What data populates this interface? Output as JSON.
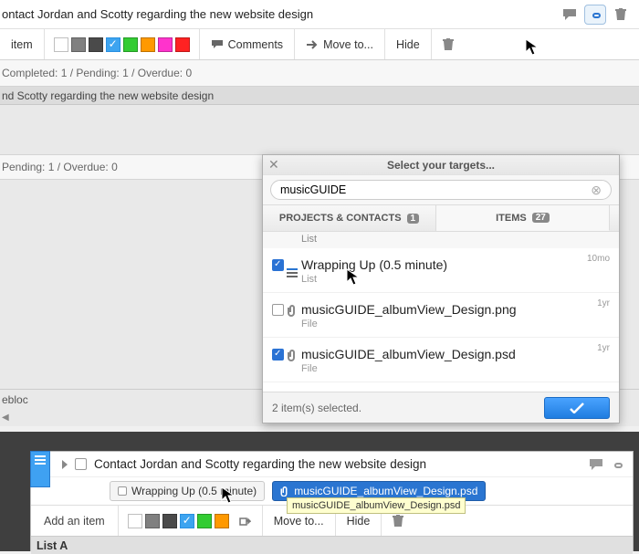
{
  "header": {
    "title": "ontact Jordan and Scotty regarding the new website design"
  },
  "toolbar": {
    "item_label": "item",
    "comments_label": "Comments",
    "move_label": "Move to...",
    "hide_label": "Hide"
  },
  "status1": "Completed: 1 / Pending: 1 / Overdue: 0",
  "midband_text": "nd Scotty regarding the new website design",
  "status2": "Pending: 1 / Overdue: 0",
  "ebloc_label": "ebloc",
  "popup": {
    "title": "Select your targets...",
    "search_value": "musicGUIDE",
    "tab1_label": "PROJECTS & CONTACTS",
    "tab1_count": "1",
    "tab2_label": "ITEMS",
    "tab2_count": "27",
    "group_label": "List",
    "items": [
      {
        "title": "Wrapping Up (0.5 minute)",
        "sub": "List",
        "age": "10mo",
        "checked": true,
        "kind": "list"
      },
      {
        "title": "musicGUIDE_albumView_Design.png",
        "sub": "File",
        "age": "1yr",
        "checked": false,
        "kind": "file"
      },
      {
        "title": "musicGUIDE_albumView_Design.psd",
        "sub": "File",
        "age": "1yr",
        "checked": true,
        "kind": "file"
      }
    ],
    "footer_text": "2 item(s) selected."
  },
  "card": {
    "title": "Contact Jordan and Scotty regarding the new website design",
    "chip_list": "Wrapping Up (0.5 minute)",
    "chip_file": "musicGUIDE_albumView_Design.psd",
    "tooltip": "musicGUIDE_albumView_Design.psd",
    "add_item": "Add an item",
    "move": "Move to...",
    "hide": "Hide",
    "list_a": "List A"
  },
  "colors": {
    "swatches": [
      "#ffffff",
      "#808080",
      "#4a4a4a",
      "#3da4f0",
      "#33cc33",
      "#ff9900",
      "#ff33cc",
      "#ff2222"
    ]
  }
}
